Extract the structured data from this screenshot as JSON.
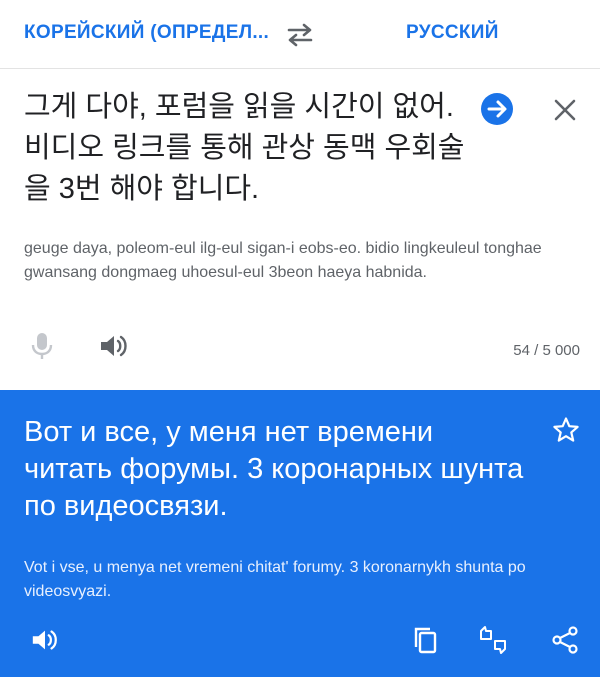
{
  "languages": {
    "source": "КОРЕЙСКИЙ (ОПРЕДЕЛ...",
    "target": "РУССКИЙ"
  },
  "source": {
    "text": "그게 다야, 포럼을 읽을 시간이 없어. 비디오 링크를 통해 관상 동맥 우회술을 3번 해야 합니다.",
    "transliteration": "geuge daya, poleom-eul ilg-eul sigan-i eobs-eo. bidio lingkeuleul tonghae gwansang dongmaeg uhoesul-eul 3beon haeya habnida.",
    "char_count": "54 / 5 000"
  },
  "result": {
    "text": "Вот и все, у меня нет времени читать форумы. 3 коронарных шунта по видеосвязи.",
    "transliteration": "Vot i vse, u menya net vremeni chitat' forumy. 3 koronarnykh shunta po videosvyazi."
  },
  "colors": {
    "accent": "#1a73e8",
    "panel_text": "#202124",
    "secondary_text": "#5f6368"
  },
  "icons": [
    "swap-icon",
    "arrow-right-icon",
    "close-icon",
    "mic-icon",
    "speaker-icon",
    "star-icon",
    "copy-icon",
    "feedback-icon",
    "share-icon"
  ]
}
